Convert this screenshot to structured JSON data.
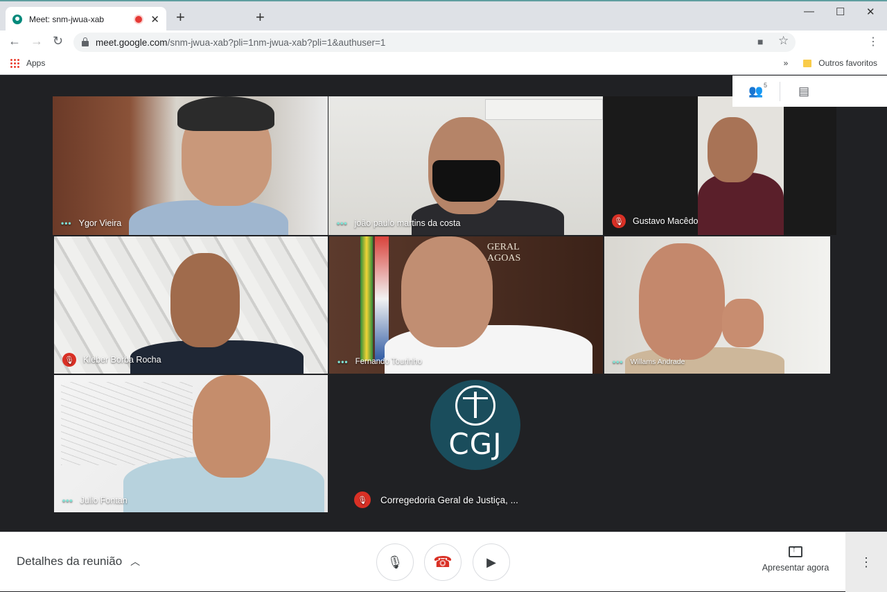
{
  "browser": {
    "tab_title": "Meet: snm-jwua-xab",
    "new_tab": "+",
    "url_host": "meet.google.com",
    "url_path": "/snm-jwua-xab?pli=1nm-jwua-xab?pli=1&authuser=1",
    "bookmarks": {
      "apps": "Apps",
      "more": "»",
      "other_favorites": "Outros favoritos"
    }
  },
  "meet": {
    "participant_count": "5",
    "participants": [
      {
        "name": "Ygor Vieira",
        "muted": false
      },
      {
        "name": "joão paulo martins da costa",
        "muted": false
      },
      {
        "name": "Gustavo Macêdo",
        "muted": true
      },
      {
        "name": "Kleber Borba Rocha",
        "muted": true
      },
      {
        "name": "Fernando Tourinho",
        "muted": false
      },
      {
        "name": "Willams Andrade",
        "muted": false
      },
      {
        "name": "Julio Fontan",
        "muted": false
      },
      {
        "name": "Corregedoria Geral de Justiça, ...",
        "muted": true
      }
    ],
    "cgj_logo_text": "CGJ",
    "wall_sign": "GERAL\nAGOAS",
    "meeting_details": "Detalhes da reunião",
    "present_now": "Apresentar agora"
  },
  "colors": {
    "accent_red": "#d93025",
    "speaking_dots": "#7fe3d6",
    "cgj_logo": "#1a4d5c"
  }
}
